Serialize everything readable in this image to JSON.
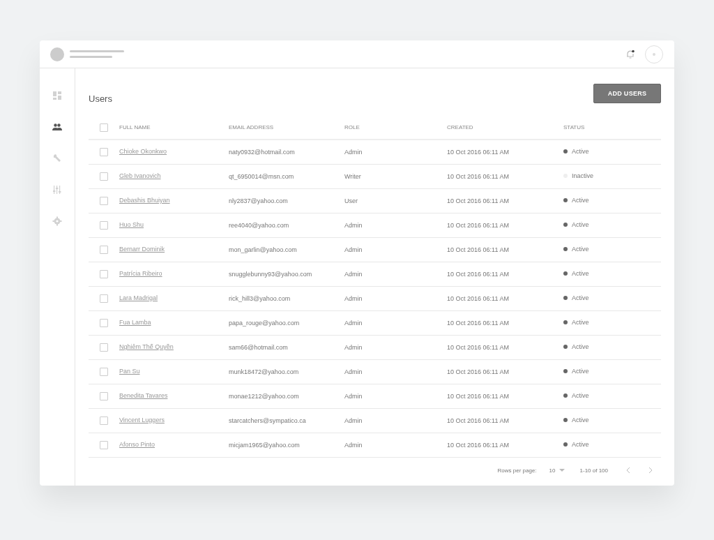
{
  "sidebar": {
    "items": [
      {
        "selected": false
      },
      {
        "selected": true
      },
      {
        "selected": false
      },
      {
        "selected": false
      },
      {
        "selected": false
      }
    ]
  },
  "page_title": "Users",
  "add_button": "ADD USERS",
  "table": {
    "select_all_checked": false,
    "columns": [
      "FULL NAME",
      "EMAIL ADDRESS",
      "ROLE",
      "CREATED",
      "STATUS"
    ],
    "rows": [
      {
        "checked": false,
        "name": "Chioke Okonkwo",
        "email": "naty0932@hotmail.com",
        "role": "Admin",
        "created": "10 Oct 2016 06:11 AM",
        "status": "Active",
        "active": true
      },
      {
        "checked": false,
        "name": "Gleb Ivanovich",
        "email": "qt_6950014@msn.com",
        "role": "Writer",
        "created": "10 Oct 2016 06:11 AM",
        "status": "Inactive",
        "active": false
      },
      {
        "checked": false,
        "name": "Debashis Bhuiyan",
        "email": "nly2837@yahoo.com",
        "role": "User",
        "created": "10 Oct 2016 06:11 AM",
        "status": "Active",
        "active": true
      },
      {
        "checked": false,
        "name": "Huo Shu",
        "email": "ree4040@yahoo.com",
        "role": "Admin",
        "created": "10 Oct 2016 06:11 AM",
        "status": "Active",
        "active": true
      },
      {
        "checked": false,
        "name": "Bernarr Dominik",
        "email": "mon_garlin@yahoo.com",
        "role": "Admin",
        "created": "10 Oct 2016 06:11 AM",
        "status": "Active",
        "active": true
      },
      {
        "checked": false,
        "name": "Patrícia Ribeiro",
        "email": "snugglebunny93@yahoo.com",
        "role": "Admin",
        "created": "10 Oct 2016 06:11 AM",
        "status": "Active",
        "active": true
      },
      {
        "checked": false,
        "name": "Lara Madrigal",
        "email": "rick_hill3@yahoo.com",
        "role": "Admin",
        "created": "10 Oct 2016 06:11 AM",
        "status": "Active",
        "active": true
      },
      {
        "checked": false,
        "name": "Fua Lamba",
        "email": "papa_rouge@yahoo.com",
        "role": "Admin",
        "created": "10 Oct 2016 06:11 AM",
        "status": "Active",
        "active": true
      },
      {
        "checked": false,
        "name": "Nghiêm Thế Quyền",
        "email": "sam66@hotmail.com",
        "role": "Admin",
        "created": "10 Oct 2016 06:11 AM",
        "status": "Active",
        "active": true
      },
      {
        "checked": false,
        "name": "Pan Su",
        "email": "munk18472@yahoo.com",
        "role": "Admin",
        "created": "10 Oct 2016 06:11 AM",
        "status": "Active",
        "active": true
      },
      {
        "checked": false,
        "name": "Benedita Tavares",
        "email": "monae1212@yahoo.com",
        "role": "Admin",
        "created": "10 Oct 2016 06:11 AM",
        "status": "Active",
        "active": true
      },
      {
        "checked": false,
        "name": "Vincent Luggers",
        "email": "starcatchers@sympatico.ca",
        "role": "Admin",
        "created": "10 Oct 2016 06:11 AM",
        "status": "Active",
        "active": true
      },
      {
        "checked": false,
        "name": "Afonso Pinto",
        "email": "micjam1965@yahoo.com",
        "role": "Admin",
        "created": "10 Oct 2016 06:11 AM",
        "status": "Active",
        "active": true
      }
    ]
  },
  "pagination": {
    "rows_per_page_label": "Rows per page:",
    "rows_per_page": "10",
    "range": "1-10 of 100"
  }
}
